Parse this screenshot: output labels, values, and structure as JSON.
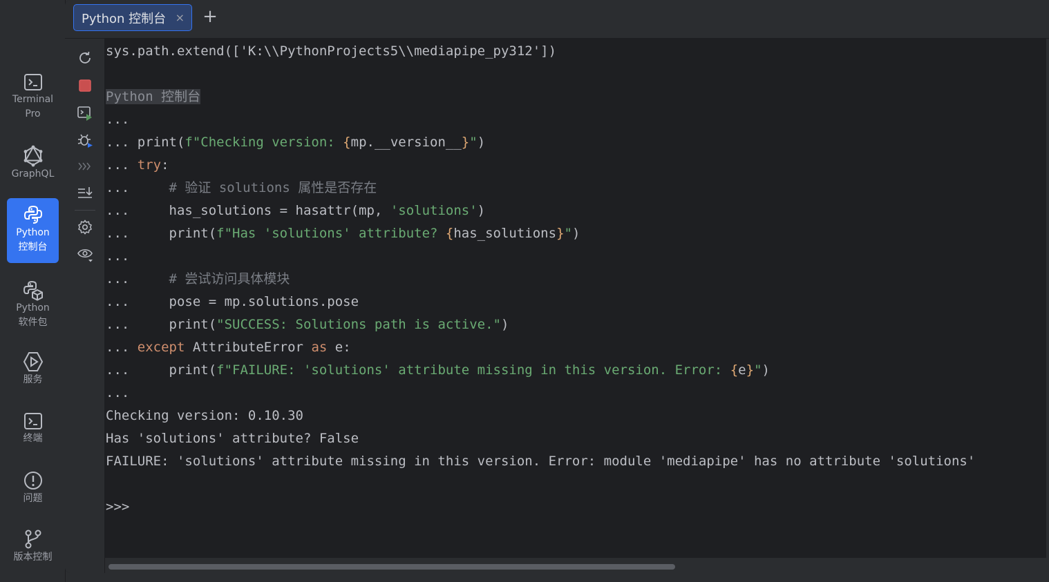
{
  "sidebar": {
    "items": [
      {
        "label": "Terminal\nPro",
        "icon": "terminal-pro-icon",
        "active": false
      },
      {
        "label": "GraphQL",
        "icon": "graphql-icon",
        "active": false
      },
      {
        "label": "Python\n控制台",
        "icon": "python-console-icon",
        "active": true
      },
      {
        "label": "Python\n软件包",
        "icon": "python-packages-icon",
        "active": false
      },
      {
        "label": "服务",
        "icon": "services-icon",
        "active": false
      },
      {
        "label": "终端",
        "icon": "terminal-icon",
        "active": false
      },
      {
        "label": "问题",
        "icon": "problems-icon",
        "active": false
      },
      {
        "label": "版本控制",
        "icon": "version-control-icon",
        "active": false
      }
    ]
  },
  "tabs": {
    "active_label": "Python 控制台",
    "close_symbol": "×",
    "add_symbol": "+"
  },
  "toolbar": {
    "icons": [
      "rerun-icon",
      "stop-icon",
      "execute-icon",
      "debug-icon",
      "history-icon",
      "soft-wrap-icon",
      "settings-icon",
      "variables-view-icon"
    ]
  },
  "console": {
    "lines": [
      "sys.path.extend(['K:\\\\PythonProjects5\\\\mediapipe_py312'])",
      "",
      "Python 控制台",
      "...",
      "... print(f\"Checking version: {mp.__version__}\")",
      "... try:",
      "...     # 验证 solutions 属性是否存在",
      "...     has_solutions = hasattr(mp, 'solutions')",
      "...     print(f\"Has 'solutions' attribute? {has_solutions}\")",
      "...",
      "...     # 尝试访问具体模块",
      "...     pose = mp.solutions.pose",
      "...     print(\"SUCCESS: Solutions path is active.\")",
      "... except AttributeError as e:",
      "...     print(f\"FAILURE: 'solutions' attribute missing in this version. Error: {e}\")",
      "...",
      "Checking version: 0.10.30",
      "Has 'solutions' attribute? False",
      "FAILURE: 'solutions' attribute missing in this version. Error: module 'mediapipe' has no attribute 'solutions'",
      "",
      ">>>"
    ]
  },
  "colors": {
    "accent": "#3574f0",
    "keyword": "#cf8e6d",
    "string": "#6aab73",
    "comment": "#7a7e85",
    "default_text": "#bcbec4",
    "background": "#1e1f22"
  }
}
